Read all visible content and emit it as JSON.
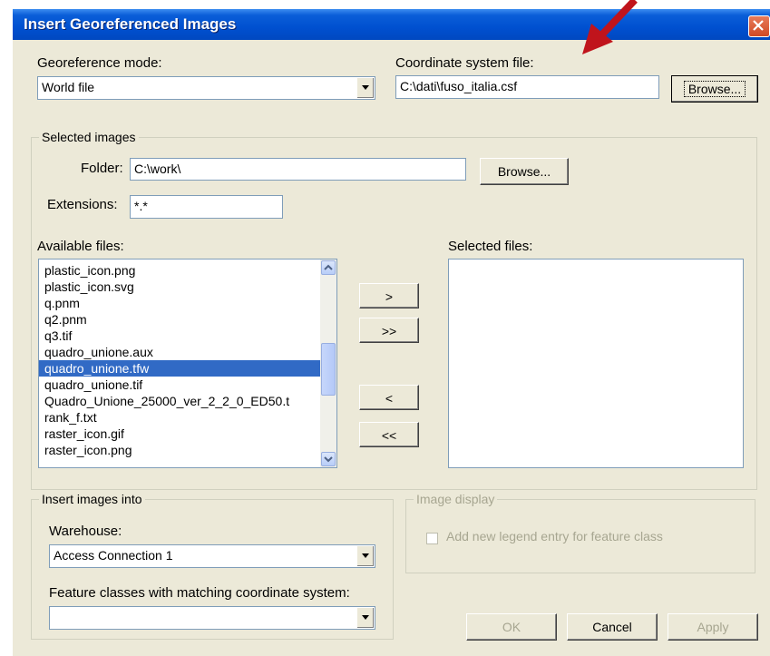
{
  "window": {
    "title": "Insert Georeferenced Images"
  },
  "georef": {
    "label": "Georeference mode:",
    "value": "World file"
  },
  "coord": {
    "label": "Coordinate system file:",
    "value": "C:\\dati\\fuso_italia.csf",
    "browse": "Browse..."
  },
  "selected_images": {
    "group_title": "Selected images",
    "folder_label": "Folder:",
    "folder_value": "C:\\work\\",
    "folder_browse": "Browse...",
    "ext_label": "Extensions:",
    "ext_value": "*.*",
    "available_label": "Available files:",
    "selected_label": "Selected files:",
    "available_files": [
      "plastic_icon.png",
      "plastic_icon.svg",
      "q.pnm",
      "q2.pnm",
      "q3.tif",
      "quadro_unione.aux",
      "quadro_unione.tfw",
      "quadro_unione.tif",
      "Quadro_Unione_25000_ver_2_2_0_ED50.t",
      "rank_f.txt",
      "raster_icon.gif",
      "raster_icon.png"
    ],
    "selected_index": 6,
    "move_one": ">",
    "move_all": ">>",
    "remove_one": "<",
    "remove_all": "<<"
  },
  "insert_into": {
    "group_title": "Insert images into",
    "warehouse_label": "Warehouse:",
    "warehouse_value": "Access Connection 1",
    "feature_label": "Feature classes with matching coordinate system:",
    "feature_value": ""
  },
  "image_display": {
    "group_title": "Image display",
    "legend_checkbox_label": "Add new legend entry for feature class",
    "legend_checked": false
  },
  "buttons": {
    "ok": "OK",
    "cancel": "Cancel",
    "apply": "Apply"
  },
  "annotation": {
    "arrow_color": "#c0141c"
  }
}
